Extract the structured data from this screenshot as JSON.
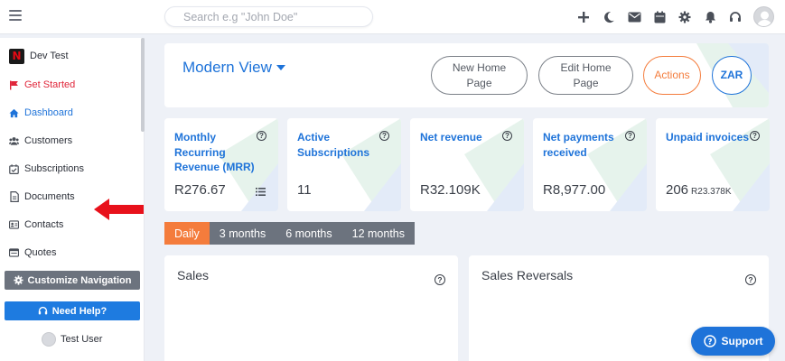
{
  "search": {
    "placeholder": "Search e.g \"John Doe\""
  },
  "sidebar": {
    "items": [
      {
        "label": "Dev Test",
        "color": "#2b2f38"
      },
      {
        "label": "Get Started",
        "color": "#e0263a"
      },
      {
        "label": "Dashboard",
        "color": "#1e73d9"
      },
      {
        "label": "Customers"
      },
      {
        "label": "Subscriptions"
      },
      {
        "label": "Documents"
      },
      {
        "label": "Contacts"
      },
      {
        "label": "Quotes"
      }
    ],
    "customize_label": "Customize Navigation",
    "help_label": "Need Help?",
    "user_name": "Test User"
  },
  "header": {
    "view_title": "Modern View",
    "buttons": {
      "new_home": "New Home Page",
      "edit_home": "Edit Home Page",
      "actions": "Actions",
      "currency": "ZAR"
    }
  },
  "metrics": [
    {
      "title": "Monthly Recurring Revenue (MRR)",
      "value": "R276.67",
      "sub": ""
    },
    {
      "title": "Active Subscriptions",
      "value": "11",
      "sub": ""
    },
    {
      "title": "Net revenue",
      "value": "R32.109K",
      "sub": ""
    },
    {
      "title": "Net payments received",
      "value": "R8,977.00",
      "sub": ""
    },
    {
      "title": "Unpaid invoices",
      "value": "206",
      "sub": "R23.378K"
    }
  ],
  "period_tabs": [
    {
      "label": "Daily",
      "active": true
    },
    {
      "label": "3 months"
    },
    {
      "label": "6 months"
    },
    {
      "label": "12 months"
    }
  ],
  "panels": {
    "sales": "Sales",
    "sales_reversals": "Sales Reversals"
  },
  "support_label": "Support",
  "colors": {
    "accent": "#1e73d9",
    "orange": "#f47c3c",
    "red": "#e0263a",
    "gray_button": "#6c737e"
  }
}
